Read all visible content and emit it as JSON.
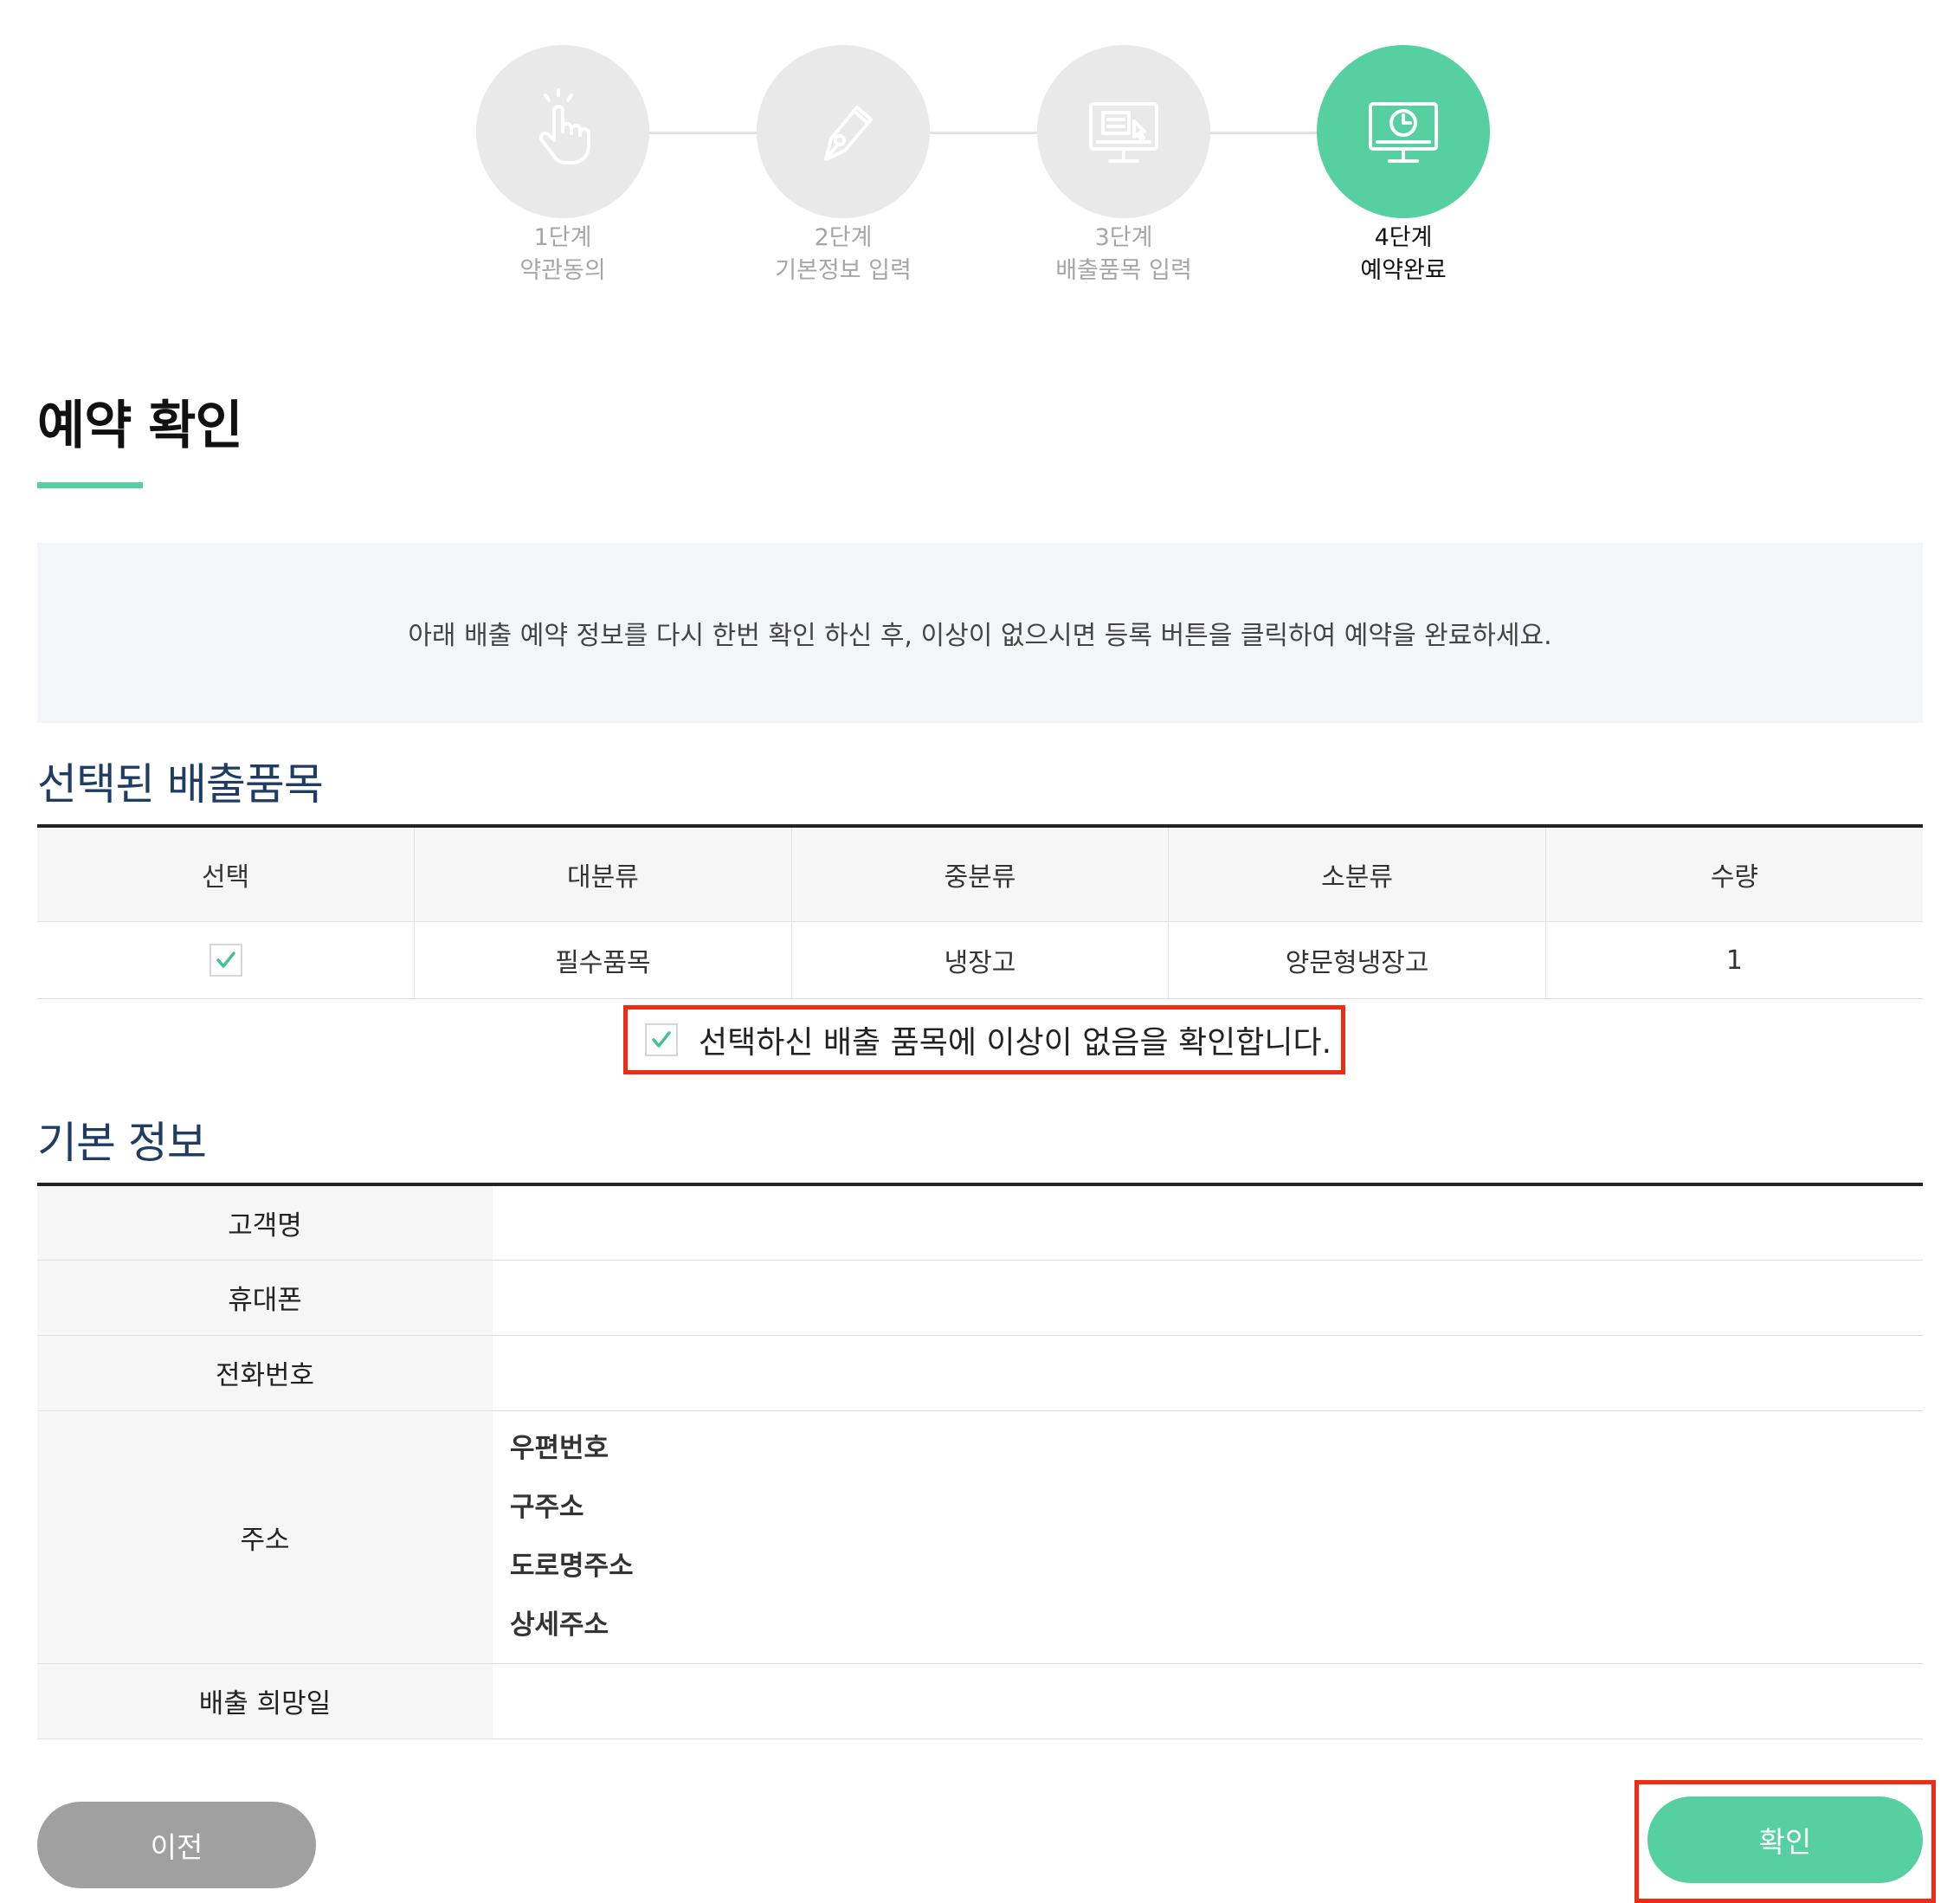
{
  "steps": [
    {
      "num": "1단계",
      "name": "약관동의",
      "icon": "hand-pointer-icon",
      "active": false
    },
    {
      "num": "2단계",
      "name": "기본정보 입력",
      "icon": "pen-icon",
      "active": false
    },
    {
      "num": "3단계",
      "name": "배출품목 입력",
      "icon": "monitor-list-icon",
      "active": false
    },
    {
      "num": "4단계",
      "name": "예약완료",
      "icon": "monitor-clock-icon",
      "active": true
    }
  ],
  "page_title": "예약 확인",
  "notice": "아래 배출 예약 정보를 다시 한번 확인 하신 후, 이상이 없으시면 등록 버튼을 클릭하여 예약을 완료하세요.",
  "items_section": {
    "title": "선택된 배출품목",
    "headers": [
      "선택",
      "대분류",
      "중분류",
      "소분류",
      "수량"
    ],
    "rows": [
      {
        "checked": true,
        "major": "필수품목",
        "middle": "냉장고",
        "minor": "양문형냉장고",
        "qty": "1"
      }
    ],
    "confirm_label": "선택하신 배출 품목에 이상이 없음을 확인합니다.",
    "confirm_checked": true
  },
  "info_section": {
    "title": "기본 정보",
    "customer_label": "고객명",
    "mobile_label": "휴대폰",
    "phone_label": "전화번호",
    "address_label": "주소",
    "address_fields": [
      "우편번호",
      "구주소",
      "도로명주소",
      "상세주소"
    ],
    "date_label": "배출 희망일"
  },
  "buttons": {
    "prev": "이전",
    "confirm": "확인"
  },
  "colors": {
    "accent": "#56d0a0",
    "heading": "#1f3d63",
    "highlight": "#ef2b12",
    "disabled": "#a0a0a0"
  }
}
